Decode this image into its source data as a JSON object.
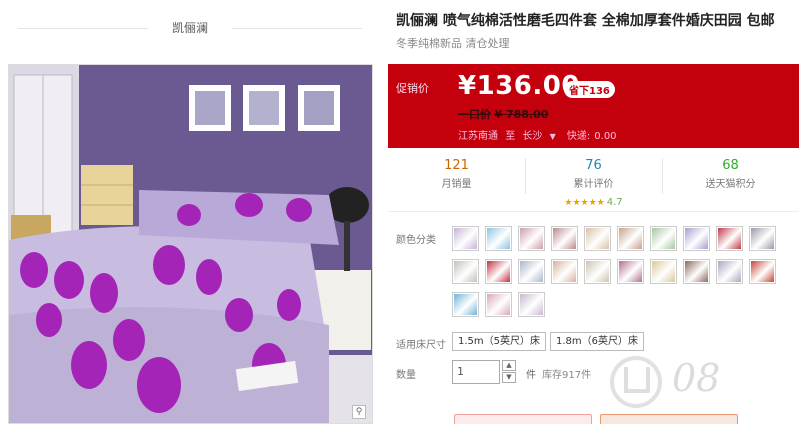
{
  "brand": {
    "name": "凯俪澜"
  },
  "product": {
    "title": "凯俪澜 喷气纯棉活性磨毛四件套 全棉加厚套件婚庆田园 包邮",
    "subtitle": "冬季纯棉新品 清仓处理"
  },
  "price": {
    "promo_label": "促销价",
    "current": "¥136.00",
    "discount_badge": "省下136",
    "original_label": "一口价",
    "original": "¥ 788.00"
  },
  "shipping": {
    "from": "江苏南通",
    "to_word": "至",
    "destination": "长沙",
    "fee_label": "快递:",
    "fee": "0.00"
  },
  "stats": {
    "monthly_sales": "121",
    "monthly_sales_label": "月销量",
    "reviews": "76",
    "reviews_label": "累计评价",
    "stars": "★★★★★",
    "score": "4.7",
    "points": "68",
    "points_label": "送天猫积分"
  },
  "sku": {
    "color_label": "颜色分类",
    "colors": [
      "#c7b3d8",
      "#8fc3e0",
      "#c9a0a8",
      "#b98a8a",
      "#d9c2a8",
      "#c8a08a",
      "#a6c7a0",
      "#a79ecf",
      "#c03a4a",
      "#9a9aa8",
      "#c2c2b8",
      "#c23040",
      "#a9b7c9",
      "#d8b0a0",
      "#cfc4b0",
      "#b07090",
      "#d9c89a",
      "#8a6a60",
      "#a8a8c0",
      "#c04838",
      "#6fb4d8",
      "#d8a8b8",
      "#c8b8d0"
    ],
    "size_label": "适用床尺寸",
    "sizes": [
      "1.5m（5英尺）床",
      "1.8m（6英尺）床"
    ]
  },
  "quantity": {
    "label": "数量",
    "value": "1",
    "unit": "件",
    "stock": "库存917件"
  },
  "icons": {
    "zoom": "zoom-icon",
    "step_up": "chevron-up-icon",
    "step_down": "chevron-down-icon",
    "caret": "caret-down-icon"
  },
  "colors": {
    "price_bg": "#c4000c",
    "accent": "#c60"
  }
}
